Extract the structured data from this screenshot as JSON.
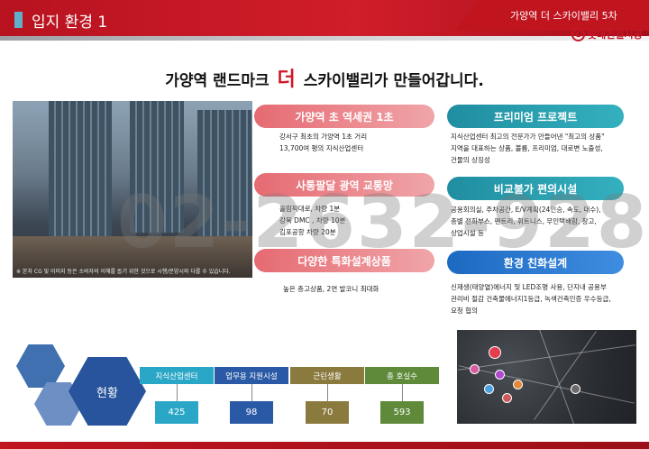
{
  "header": {
    "title": "입지 환경 1",
    "project": "가양역  더 스카이밸리 5차",
    "logo_text": "롯데건설시공",
    "logo_mark": "L"
  },
  "headline": {
    "before": "가양역 랜드마크",
    "accent": "더",
    "after": "스카이밸리가 만들어갑니다."
  },
  "photo": {
    "caption": "※ 본자 CG 및 이미지 등은 소비자의 이해를 돕기 위한 것으로 시행/분양시와 다를 수 있습니다."
  },
  "watermark": "02-2632-9288",
  "features": {
    "left": [
      {
        "title": "가양역 초 역세권 1초",
        "lines": [
          "강서구 최초의  가양역 1초 거리",
          "13,700여 평의 지식산업센터"
        ]
      },
      {
        "title": "사통팔달 광역 교통망",
        "lines": [
          "올림픽대로, 차량 1분",
          "강북 DMC , 차량 10분",
          "김포공항 차량 20분"
        ]
      },
      {
        "title": "다양한 특화설계상품",
        "lines": [
          "높은 층고상품, 2면 발코니 최대화"
        ]
      }
    ],
    "right": [
      {
        "title": "프리미엄 프로젝트",
        "lines": [
          "지식산업센터 최고의 전문가가 만들어낸 \"최고의 상품\"",
          "지역을 대표하는 상품, 볼륨, 프리미엄, 대로변 노출성,",
          "건물의 상징성"
        ]
      },
      {
        "title": "비교불가 편의시설",
        "lines": [
          "공용회의실, 주차공간, E/V계획(24인승, 속도, 대수),",
          "층별 전화부스, 팬트리, 휘트니스, 무인택배함, 창고,",
          "상업시설 등"
        ]
      },
      {
        "title": "환경 친화설계",
        "lines": [
          "신재생(태양열)에너지 및 LED조명 사용, 단지내 공용부",
          "관리비 절감 건축물에너지1등급, 녹색건축인증 우수등급,",
          "요청 협의"
        ]
      }
    ]
  },
  "status": {
    "label": "현황",
    "items": [
      {
        "name": "지식산업센터",
        "value": "425",
        "color": "#2aa7c6"
      },
      {
        "name": "업무용 지원시설",
        "value": "98",
        "color": "#2a5aa5"
      },
      {
        "name": "근린생활",
        "value": "70",
        "color": "#8a7a3e"
      },
      {
        "name": "총 호실수",
        "value": "593",
        "color": "#5f8a3a"
      }
    ]
  },
  "colors": {
    "brand_red": "#c81524",
    "teal": "#1f8ea0",
    "blue": "#1c69c2",
    "pink": "#e66a72"
  }
}
